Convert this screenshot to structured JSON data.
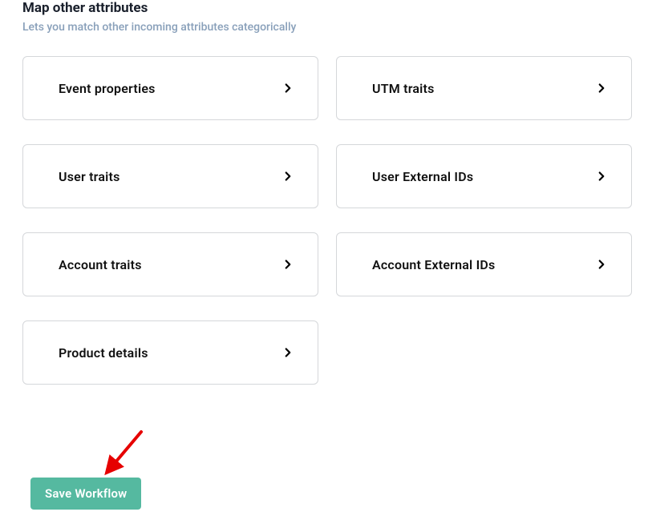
{
  "section": {
    "title": "Map other attributes",
    "subtitle": "Lets you match other incoming attributes categorically"
  },
  "cards": {
    "event_properties": "Event properties",
    "utm_traits": "UTM traits",
    "user_traits": "User traits",
    "user_external_ids": "User External IDs",
    "account_traits": "Account traits",
    "account_external_ids": "Account External IDs",
    "product_details": "Product details"
  },
  "actions": {
    "save_workflow": "Save Workflow"
  }
}
